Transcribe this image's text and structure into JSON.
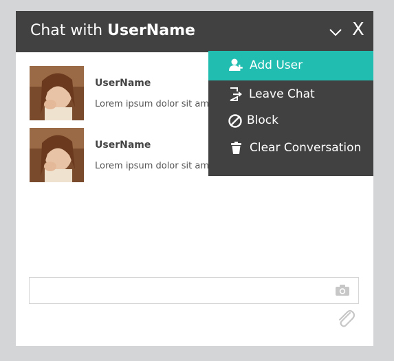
{
  "header": {
    "title_prefix": "Chat with ",
    "title_name": "UserName",
    "close_label": "X"
  },
  "messages": [
    {
      "user": "UserName",
      "text": "Lorem ipsum dolor sit amet"
    },
    {
      "user": "UserName",
      "text": "Lorem ipsum dolor sit amet"
    }
  ],
  "menu": {
    "items": [
      {
        "label": "Add User",
        "icon": "add-user-icon",
        "active": true
      },
      {
        "label": "Leave Chat",
        "icon": "leave-icon"
      },
      {
        "label": "Block",
        "icon": "block-icon"
      },
      {
        "label": "Clear Conversation",
        "icon": "trash-icon"
      }
    ]
  },
  "composer": {
    "value": "",
    "placeholder": ""
  },
  "colors": {
    "header_bg": "#414141",
    "accent": "#21bdb1",
    "page_bg": "#d4d5d6"
  }
}
